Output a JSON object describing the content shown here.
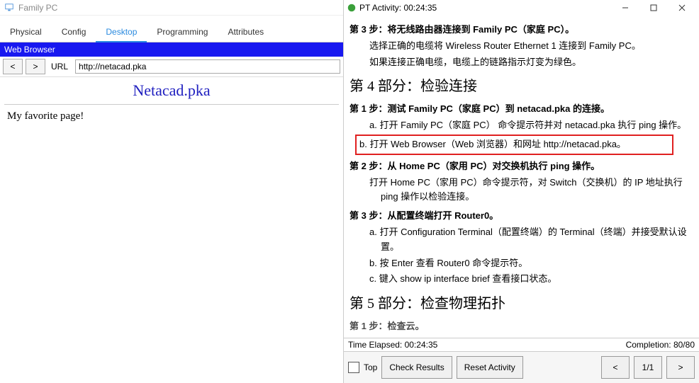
{
  "left": {
    "window_title": "Family PC",
    "tabs": [
      "Physical",
      "Config",
      "Desktop",
      "Programming",
      "Attributes"
    ],
    "active_tab_index": 2,
    "panel_label": "Web Browser",
    "back": "<",
    "forward": ">",
    "url_label": "URL",
    "url_value": "http://netacad.pka",
    "page_heading": "Netacad.pka",
    "page_text": "My favorite page!"
  },
  "right": {
    "window_title": "PT Activity: 00:24:35",
    "content": {
      "step3_title": "第 3 步：将无线路由器连接到 Family PC（家庭 PC）。",
      "step3_a": "选择正确的电缆将 Wireless Router Ethernet 1 连接到 Family PC。",
      "step3_b": "如果连接正确电缆，电缆上的链路指示灯变为绿色。",
      "part4_title": "第 4 部分：检验连接",
      "p4_step1_title": "第 1 步：测试 Family PC（家庭 PC）到 netacad.pka 的连接。",
      "p4_step1_a": "a.  打开 Family PC（家庭 PC） 命令提示符并对 netacad.pka 执行 ping 操作。",
      "p4_step1_b": "b.  打开 Web Browser（Web 浏览器）和网址 http://netacad.pka。",
      "p4_step2_title": "第 2 步：从 Home PC（家用 PC）对交换机执行 ping 操作。",
      "p4_step2_text": "打开 Home PC（家用 PC）命令提示符，对 Switch（交换机）的 IP 地址执行 ping 操作以检验连接。",
      "p4_step3_title": "第 3 步：从配置终端打开 Router0。",
      "p4_step3_a": "a.  打开 Configuration Terminal（配置终端）的 Terminal（终端）并接受默认设置。",
      "p4_step3_b": "b.  按 Enter 查看 Router0 命令提示符。",
      "p4_step3_c": "c.  键入 show ip interface brief 查看接口状态。",
      "part5_title": "第 5 部分：检查物理拓扑",
      "p5_step1_title": "第 1 步：检查云。"
    },
    "time_elapsed_label": "Time Elapsed: 00:24:35",
    "completion_label": "Completion: 80/80",
    "top_label": "Top",
    "check_results": "Check Results",
    "reset_activity": "Reset Activity",
    "prev": "<",
    "page_indicator": "1/1",
    "next": ">"
  }
}
